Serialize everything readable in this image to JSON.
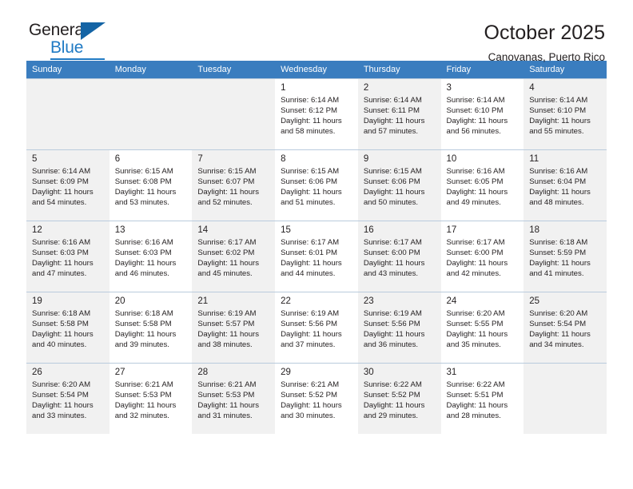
{
  "brand": {
    "name_top": "General",
    "name_bottom": "Blue",
    "triangle_color": "#1464a5",
    "blue_color": "#1f7ac4"
  },
  "header": {
    "title": "October 2025",
    "subtitle": "Canovanas, Puerto Rico"
  },
  "colors": {
    "header_bar": "#3a7dbf",
    "shaded_cell": "#f1f1f1",
    "grid_line": "#9fb8d0",
    "text": "#231f20"
  },
  "weekday_headers": [
    "Sunday",
    "Monday",
    "Tuesday",
    "Wednesday",
    "Thursday",
    "Friday",
    "Saturday"
  ],
  "weeks": [
    [
      {
        "day": "",
        "lines": [],
        "empty": true
      },
      {
        "day": "",
        "lines": [],
        "empty": true
      },
      {
        "day": "",
        "lines": [],
        "empty": true
      },
      {
        "day": "1",
        "lines": [
          "Sunrise: 6:14 AM",
          "Sunset: 6:12 PM",
          "Daylight: 11 hours",
          "and 58 minutes."
        ],
        "empty": false
      },
      {
        "day": "2",
        "lines": [
          "Sunrise: 6:14 AM",
          "Sunset: 6:11 PM",
          "Daylight: 11 hours",
          "and 57 minutes."
        ],
        "empty": false
      },
      {
        "day": "3",
        "lines": [
          "Sunrise: 6:14 AM",
          "Sunset: 6:10 PM",
          "Daylight: 11 hours",
          "and 56 minutes."
        ],
        "empty": false
      },
      {
        "day": "4",
        "lines": [
          "Sunrise: 6:14 AM",
          "Sunset: 6:10 PM",
          "Daylight: 11 hours",
          "and 55 minutes."
        ],
        "empty": false
      }
    ],
    [
      {
        "day": "5",
        "lines": [
          "Sunrise: 6:14 AM",
          "Sunset: 6:09 PM",
          "Daylight: 11 hours",
          "and 54 minutes."
        ],
        "empty": false
      },
      {
        "day": "6",
        "lines": [
          "Sunrise: 6:15 AM",
          "Sunset: 6:08 PM",
          "Daylight: 11 hours",
          "and 53 minutes."
        ],
        "empty": false
      },
      {
        "day": "7",
        "lines": [
          "Sunrise: 6:15 AM",
          "Sunset: 6:07 PM",
          "Daylight: 11 hours",
          "and 52 minutes."
        ],
        "empty": false
      },
      {
        "day": "8",
        "lines": [
          "Sunrise: 6:15 AM",
          "Sunset: 6:06 PM",
          "Daylight: 11 hours",
          "and 51 minutes."
        ],
        "empty": false
      },
      {
        "day": "9",
        "lines": [
          "Sunrise: 6:15 AM",
          "Sunset: 6:06 PM",
          "Daylight: 11 hours",
          "and 50 minutes."
        ],
        "empty": false
      },
      {
        "day": "10",
        "lines": [
          "Sunrise: 6:16 AM",
          "Sunset: 6:05 PM",
          "Daylight: 11 hours",
          "and 49 minutes."
        ],
        "empty": false
      },
      {
        "day": "11",
        "lines": [
          "Sunrise: 6:16 AM",
          "Sunset: 6:04 PM",
          "Daylight: 11 hours",
          "and 48 minutes."
        ],
        "empty": false
      }
    ],
    [
      {
        "day": "12",
        "lines": [
          "Sunrise: 6:16 AM",
          "Sunset: 6:03 PM",
          "Daylight: 11 hours",
          "and 47 minutes."
        ],
        "empty": false
      },
      {
        "day": "13",
        "lines": [
          "Sunrise: 6:16 AM",
          "Sunset: 6:03 PM",
          "Daylight: 11 hours",
          "and 46 minutes."
        ],
        "empty": false
      },
      {
        "day": "14",
        "lines": [
          "Sunrise: 6:17 AM",
          "Sunset: 6:02 PM",
          "Daylight: 11 hours",
          "and 45 minutes."
        ],
        "empty": false
      },
      {
        "day": "15",
        "lines": [
          "Sunrise: 6:17 AM",
          "Sunset: 6:01 PM",
          "Daylight: 11 hours",
          "and 44 minutes."
        ],
        "empty": false
      },
      {
        "day": "16",
        "lines": [
          "Sunrise: 6:17 AM",
          "Sunset: 6:00 PM",
          "Daylight: 11 hours",
          "and 43 minutes."
        ],
        "empty": false
      },
      {
        "day": "17",
        "lines": [
          "Sunrise: 6:17 AM",
          "Sunset: 6:00 PM",
          "Daylight: 11 hours",
          "and 42 minutes."
        ],
        "empty": false
      },
      {
        "day": "18",
        "lines": [
          "Sunrise: 6:18 AM",
          "Sunset: 5:59 PM",
          "Daylight: 11 hours",
          "and 41 minutes."
        ],
        "empty": false
      }
    ],
    [
      {
        "day": "19",
        "lines": [
          "Sunrise: 6:18 AM",
          "Sunset: 5:58 PM",
          "Daylight: 11 hours",
          "and 40 minutes."
        ],
        "empty": false
      },
      {
        "day": "20",
        "lines": [
          "Sunrise: 6:18 AM",
          "Sunset: 5:58 PM",
          "Daylight: 11 hours",
          "and 39 minutes."
        ],
        "empty": false
      },
      {
        "day": "21",
        "lines": [
          "Sunrise: 6:19 AM",
          "Sunset: 5:57 PM",
          "Daylight: 11 hours",
          "and 38 minutes."
        ],
        "empty": false
      },
      {
        "day": "22",
        "lines": [
          "Sunrise: 6:19 AM",
          "Sunset: 5:56 PM",
          "Daylight: 11 hours",
          "and 37 minutes."
        ],
        "empty": false
      },
      {
        "day": "23",
        "lines": [
          "Sunrise: 6:19 AM",
          "Sunset: 5:56 PM",
          "Daylight: 11 hours",
          "and 36 minutes."
        ],
        "empty": false
      },
      {
        "day": "24",
        "lines": [
          "Sunrise: 6:20 AM",
          "Sunset: 5:55 PM",
          "Daylight: 11 hours",
          "and 35 minutes."
        ],
        "empty": false
      },
      {
        "day": "25",
        "lines": [
          "Sunrise: 6:20 AM",
          "Sunset: 5:54 PM",
          "Daylight: 11 hours",
          "and 34 minutes."
        ],
        "empty": false
      }
    ],
    [
      {
        "day": "26",
        "lines": [
          "Sunrise: 6:20 AM",
          "Sunset: 5:54 PM",
          "Daylight: 11 hours",
          "and 33 minutes."
        ],
        "empty": false
      },
      {
        "day": "27",
        "lines": [
          "Sunrise: 6:21 AM",
          "Sunset: 5:53 PM",
          "Daylight: 11 hours",
          "and 32 minutes."
        ],
        "empty": false
      },
      {
        "day": "28",
        "lines": [
          "Sunrise: 6:21 AM",
          "Sunset: 5:53 PM",
          "Daylight: 11 hours",
          "and 31 minutes."
        ],
        "empty": false
      },
      {
        "day": "29",
        "lines": [
          "Sunrise: 6:21 AM",
          "Sunset: 5:52 PM",
          "Daylight: 11 hours",
          "and 30 minutes."
        ],
        "empty": false
      },
      {
        "day": "30",
        "lines": [
          "Sunrise: 6:22 AM",
          "Sunset: 5:52 PM",
          "Daylight: 11 hours",
          "and 29 minutes."
        ],
        "empty": false
      },
      {
        "day": "31",
        "lines": [
          "Sunrise: 6:22 AM",
          "Sunset: 5:51 PM",
          "Daylight: 11 hours",
          "and 28 minutes."
        ],
        "empty": false
      },
      {
        "day": "",
        "lines": [],
        "empty": true
      }
    ]
  ]
}
